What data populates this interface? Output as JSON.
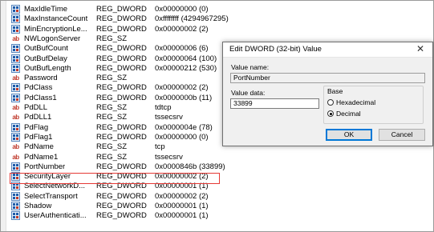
{
  "registry": {
    "rows": [
      {
        "name": "MaxIdleTime",
        "type": "REG_DWORD",
        "value": "0x00000000 (0)",
        "icon": "binary-value-icon"
      },
      {
        "name": "MaxInstanceCount",
        "type": "REG_DWORD",
        "value": "0xffffffff (4294967295)",
        "icon": "binary-value-icon"
      },
      {
        "name": "MinEncryptionLe...",
        "type": "REG_DWORD",
        "value": "0x00000002 (2)",
        "icon": "binary-value-icon"
      },
      {
        "name": "NWLogonServer",
        "type": "REG_SZ",
        "value": "",
        "icon": "string-value-icon"
      },
      {
        "name": "OutBufCount",
        "type": "REG_DWORD",
        "value": "0x00000006 (6)",
        "icon": "binary-value-icon"
      },
      {
        "name": "OutBufDelay",
        "type": "REG_DWORD",
        "value": "0x00000064 (100)",
        "icon": "binary-value-icon"
      },
      {
        "name": "OutBufLength",
        "type": "REG_DWORD",
        "value": "0x00000212 (530)",
        "icon": "binary-value-icon"
      },
      {
        "name": "Password",
        "type": "REG_SZ",
        "value": "",
        "icon": "string-value-icon"
      },
      {
        "name": "PdClass",
        "type": "REG_DWORD",
        "value": "0x00000002 (2)",
        "icon": "binary-value-icon"
      },
      {
        "name": "PdClass1",
        "type": "REG_DWORD",
        "value": "0x0000000b (11)",
        "icon": "binary-value-icon"
      },
      {
        "name": "PdDLL",
        "type": "REG_SZ",
        "value": "tdtcp",
        "icon": "string-value-icon"
      },
      {
        "name": "PdDLL1",
        "type": "REG_SZ",
        "value": "tssecsrv",
        "icon": "string-value-icon"
      },
      {
        "name": "PdFlag",
        "type": "REG_DWORD",
        "value": "0x0000004e (78)",
        "icon": "binary-value-icon"
      },
      {
        "name": "PdFlag1",
        "type": "REG_DWORD",
        "value": "0x00000000 (0)",
        "icon": "binary-value-icon"
      },
      {
        "name": "PdName",
        "type": "REG_SZ",
        "value": "tcp",
        "icon": "string-value-icon"
      },
      {
        "name": "PdName1",
        "type": "REG_SZ",
        "value": "tssecsrv",
        "icon": "string-value-icon"
      },
      {
        "name": "PortNumber",
        "type": "REG_DWORD",
        "value": "0x0000846b (33899)",
        "icon": "binary-value-icon"
      },
      {
        "name": "SecurityLayer",
        "type": "REG_DWORD",
        "value": "0x00000002 (2)",
        "icon": "binary-value-icon"
      },
      {
        "name": "SelectNetworkD...",
        "type": "REG_DWORD",
        "value": "0x00000001 (1)",
        "icon": "binary-value-icon"
      },
      {
        "name": "SelectTransport",
        "type": "REG_DWORD",
        "value": "0x00000002 (2)",
        "icon": "binary-value-icon"
      },
      {
        "name": "Shadow",
        "type": "REG_DWORD",
        "value": "0x00000001 (1)",
        "icon": "binary-value-icon"
      },
      {
        "name": "UserAuthenticati...",
        "type": "REG_DWORD",
        "value": "0x00000001 (1)",
        "icon": "binary-value-icon"
      }
    ],
    "highlight_color": "#e53935"
  },
  "dialog": {
    "title": "Edit DWORD (32-bit) Value",
    "close_glyph": "✕",
    "value_name_label": "Value name:",
    "value_name": "PortNumber",
    "value_data_label": "Value data:",
    "value_data": "33899",
    "base_label": "Base",
    "hex_label": "Hexadecimal",
    "dec_label": "Decimal",
    "selected_base": "Decimal",
    "ok_label": "OK",
    "cancel_label": "Cancel"
  }
}
